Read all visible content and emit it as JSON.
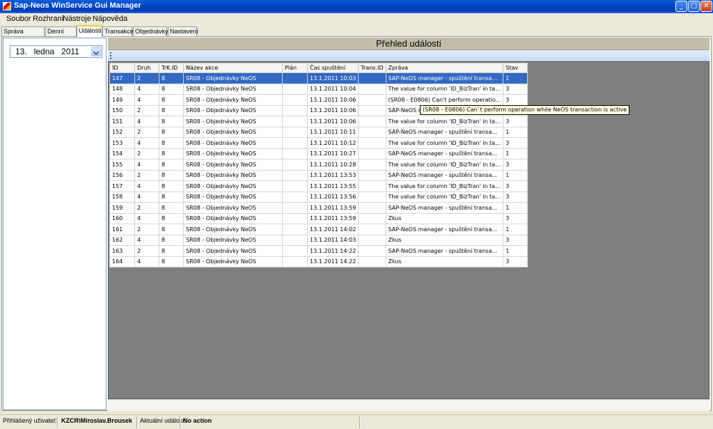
{
  "window": {
    "title": "Sap-Neos WinService Gui Manager"
  },
  "menu": [
    "Soubor",
    "Rozhraní",
    "Nástroje",
    "Nápověda"
  ],
  "tabs": [
    "Správa rozhraní",
    "Denní plán",
    "Události",
    "Transakce",
    "Objednávky",
    "Nastavení"
  ],
  "active_tab": "Události",
  "datepicker": {
    "value": "13.   ledna   2011"
  },
  "panel": {
    "title": "Přehled událostí"
  },
  "grid": {
    "columns": [
      "ID",
      "Druh",
      "TrK.ID",
      "Název akce",
      "Plán",
      "Čas spuštění",
      "Trans.ID",
      "Zpráva",
      "Stav"
    ],
    "rows": [
      [
        "147",
        "2",
        "8",
        "SR08 - Objednávky NeOS",
        "",
        "13.1.2011 10:03",
        "",
        "SAP-NeOS manager - spuštění transa...",
        "1"
      ],
      [
        "148",
        "4",
        "8",
        "SR08 - Objednávky NeOS",
        "",
        "13.1.2011 10:04",
        "",
        "The value for column 'ID_BizTran' in ta...",
        "3"
      ],
      [
        "149",
        "4",
        "8",
        "SR08 - Objednávky NeOS",
        "",
        "13.1.2011 10:06",
        "",
        "(SR08 - E0806) Can't perform operatio...",
        "3"
      ],
      [
        "150",
        "2",
        "8",
        "SR08 - Objednávky NeOS",
        "",
        "13.1.2011 10:06",
        "",
        "SAP-NeOS ma",
        "1"
      ],
      [
        "151",
        "4",
        "8",
        "SR08 - Objednávky NeOS",
        "",
        "13.1.2011 10:06",
        "",
        "The value for column 'ID_BizTran' in ta...",
        "3"
      ],
      [
        "152",
        "2",
        "8",
        "SR08 - Objednávky NeOS",
        "",
        "13.1.2011 10:11",
        "",
        "SAP-NeOS manager - spuštění transa...",
        "1"
      ],
      [
        "153",
        "4",
        "8",
        "SR08 - Objednávky NeOS",
        "",
        "13.1.2011 10:12",
        "",
        "The value for column 'ID_BizTran' in ta...",
        "3"
      ],
      [
        "154",
        "2",
        "8",
        "SR08 - Objednávky NeOS",
        "",
        "13.1.2011 10:27",
        "",
        "SAP-NeOS manager - spuštění transa...",
        "1"
      ],
      [
        "155",
        "4",
        "8",
        "SR08 - Objednávky NeOS",
        "",
        "13.1.2011 10:28",
        "",
        "The value for column 'ID_BizTran' in ta...",
        "3"
      ],
      [
        "156",
        "2",
        "8",
        "SR08 - Objednávky NeOS",
        "",
        "13.1.2011 13:53",
        "",
        "SAP-NeOS manager - spuštění transa...",
        "1"
      ],
      [
        "157",
        "4",
        "8",
        "SR08 - Objednávky NeOS",
        "",
        "13.1.2011 13:55",
        "",
        "The value for column 'ID_BizTran' in ta...",
        "3"
      ],
      [
        "158",
        "4",
        "8",
        "SR08 - Objednávky NeOS",
        "",
        "13.1.2011 13:56",
        "",
        "The value for column 'ID_BizTran' in ta...",
        "3"
      ],
      [
        "159",
        "2",
        "8",
        "SR08 - Objednávky NeOS",
        "",
        "13.1.2011 13:59",
        "",
        "SAP-NeOS manager - spuštění transa...",
        "1"
      ],
      [
        "160",
        "4",
        "8",
        "SR08 - Objednávky NeOS",
        "",
        "13.1.2011 13:59",
        "",
        "Zkus",
        "3"
      ],
      [
        "161",
        "2",
        "8",
        "SR08 - Objednávky NeOS",
        "",
        "13.1.2011 14:02",
        "",
        "SAP-NeOS manager - spuštění transa...",
        "1"
      ],
      [
        "162",
        "4",
        "8",
        "SR08 - Objednávky NeOS",
        "",
        "13.1.2011 14:03",
        "",
        "Zkus",
        "3"
      ],
      [
        "163",
        "2",
        "8",
        "SR08 - Objednávky NeOS",
        "",
        "13.1.2011 14:22",
        "",
        "SAP-NeOS manager - spuštění transa...",
        "1"
      ],
      [
        "164",
        "4",
        "8",
        "SR08 - Objednávky NeOS",
        "",
        "13.1.2011 14:22",
        "",
        "Zkus",
        "3"
      ]
    ],
    "selected_row": 0
  },
  "tooltip": {
    "text": "(SR08 - E0806) Can`t perform operation while NeOS transaction is active"
  },
  "status": {
    "user_label": "Přihlášený uživatel:",
    "user_value": "KZCR\\Miroslav.Brousek",
    "event_label": "Aktuální událost:",
    "event_value": "No action"
  },
  "colors": {
    "titlebar": "#0047c8",
    "selection": "#316ac5",
    "grid_bg": "#808080",
    "header_strip": "#c3bda8"
  },
  "icons": {
    "window_buttons": [
      "minimize-icon",
      "maximize-icon",
      "close-icon"
    ],
    "dropdown": "chevron-down-icon"
  }
}
